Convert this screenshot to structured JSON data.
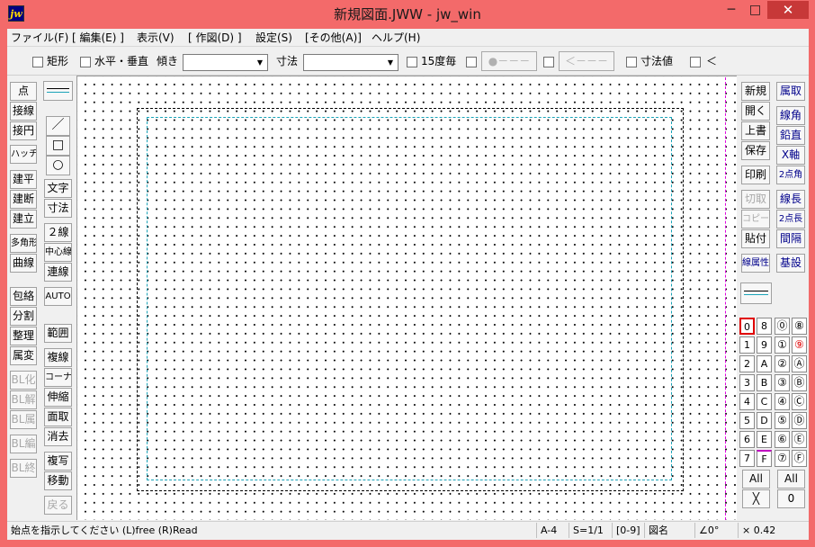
{
  "window": {
    "title": "新規図面.JWW - jw_win",
    "icon_label": "jw",
    "minimize": "─",
    "maximize": "□",
    "close": "✕"
  },
  "menu": [
    "ファイル(F)",
    "[ 編集(E) ]",
    "表示(V)",
    "[ 作図(D) ]",
    "設定(S)",
    "[その他(A)]",
    "ヘルプ(H)"
  ],
  "toolbar": {
    "rect_label": "矩形",
    "hv_label": "水平・垂直",
    "tilt_label": "傾き",
    "dim_label": "寸法",
    "deg15_label": "15度毎",
    "btn_circle_dash": "●－－－",
    "btn_arrow_dash": "＜－－－",
    "dimval_label": "寸法値",
    "lt_label": "＜"
  },
  "left_col1": [
    "点",
    "接線",
    "接円",
    "ハッチ",
    "建平",
    "建断",
    "建立",
    "多角形",
    "曲線",
    "包絡",
    "分割",
    "整理",
    "属変",
    "BL化",
    "BL解",
    "BL属",
    "BL編",
    "BL終"
  ],
  "left_col2": {
    "line": "／",
    "rect": "□",
    "circle": "○",
    "items": [
      "文字",
      "寸法",
      "２線",
      "中心線",
      "連線",
      "AUTO",
      "範囲",
      "複線",
      "コーナー",
      "伸縮",
      "面取",
      "消去",
      "複写",
      "移動",
      "戻る"
    ]
  },
  "right_col1": [
    "新規",
    "開く",
    "上書",
    "保存",
    "印刷",
    "切取",
    "コピー",
    "貼付",
    "線属性"
  ],
  "right_col2": [
    "属取",
    "線角",
    "鉛直",
    "X軸",
    "2点角",
    "線長",
    "2点長",
    "間隔",
    "基設"
  ],
  "layers": {
    "num": [
      "0",
      "1",
      "2",
      "3",
      "4",
      "5",
      "6",
      "7"
    ],
    "hex": [
      "8",
      "9",
      "A",
      "B",
      "C",
      "D",
      "E",
      "F"
    ],
    "circ_num": [
      "⓪",
      "①",
      "②",
      "③",
      "④",
      "⑤",
      "⑥",
      "⑦"
    ],
    "circ_hex": [
      "⑧",
      "⑨",
      "Ⓐ",
      "Ⓑ",
      "Ⓒ",
      "Ⓓ",
      "Ⓔ",
      "Ⓕ"
    ],
    "all": "All",
    "all2": "All",
    "x": "╳",
    "zero": "0"
  },
  "status": {
    "message": "始点を指示してください (L)free (R)Read",
    "paper": "A-4",
    "scale": "S=1/1",
    "layer_range": "[0-9]",
    "drawing_name": "図名",
    "angle": "∠0°",
    "lineweight": "× 0.42"
  },
  "colors": {
    "titlebar": "#f36a6a",
    "close_button": "#c73838",
    "frame_inner": "#1aa3b8",
    "guide_line": "#e000e0",
    "active_layer": "#e00000"
  }
}
